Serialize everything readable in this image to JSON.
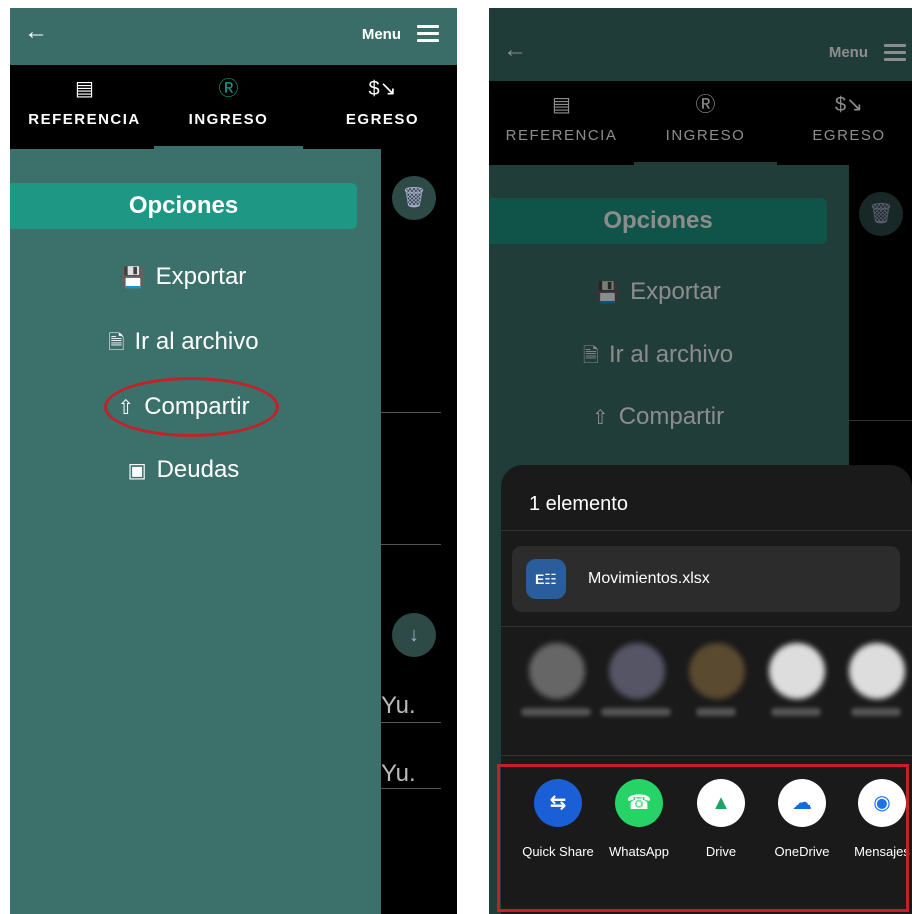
{
  "left_screen": {
    "menu_label": "Menu",
    "tabs": [
      {
        "label": "REFERENCIA",
        "icon": "receipt-icon"
      },
      {
        "label": "INGRESO",
        "icon": "dollar-circle-icon"
      },
      {
        "label": "EGRESO",
        "icon": "dollar-down-icon"
      }
    ],
    "options_title": "Opciones",
    "options": [
      {
        "label": "Exportar",
        "icon": "save-icon"
      },
      {
        "label": "Ir al archivo",
        "icon": "file-link-icon"
      },
      {
        "label": "Compartir",
        "icon": "share-icon"
      },
      {
        "label": "Deudas",
        "icon": "wallet-icon"
      }
    ],
    "background_text": [
      "Yu.",
      "Yu."
    ]
  },
  "right_screen": {
    "menu_label": "Menu",
    "tabs": [
      {
        "label": "REFERENCIA"
      },
      {
        "label": "INGRESO"
      },
      {
        "label": "EGRESO"
      }
    ],
    "options_title": "Opciones",
    "options": [
      {
        "label": "Exportar"
      },
      {
        "label": "Ir al archivo"
      },
      {
        "label": "Compartir"
      }
    ],
    "share_sheet": {
      "title": "1 elemento",
      "file_name": "Movimientos.xlsx",
      "apps": [
        {
          "label": "Quick Share",
          "icon": "quick-share-icon",
          "color": "#1a5fd6"
        },
        {
          "label": "WhatsApp",
          "icon": "whatsapp-icon",
          "color": "#25d366"
        },
        {
          "label": "Drive",
          "icon": "drive-icon",
          "color": "#ffffff"
        },
        {
          "label": "OneDrive",
          "icon": "onedrive-icon",
          "color": "#ffffff"
        },
        {
          "label": "Mensajes",
          "icon": "messages-icon",
          "color": "#ffffff"
        }
      ]
    }
  },
  "colors": {
    "appbar": "#3a6d68",
    "drawer": "#3b706b",
    "accent": "#1e9884",
    "highlight": "#c42027"
  }
}
